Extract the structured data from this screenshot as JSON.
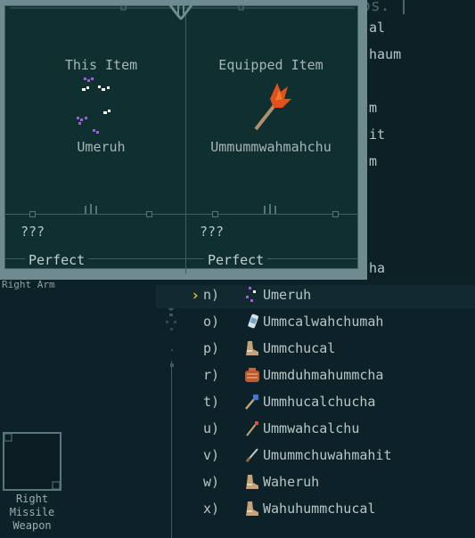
{
  "background": {
    "title_fragment": "os.",
    "visible_fragments": [
      "al",
      "haum",
      "m",
      "it",
      "m",
      "ha"
    ]
  },
  "compare": {
    "left": {
      "heading": "This Item",
      "name": "Umeruh",
      "lore": "???",
      "quality": "Perfect"
    },
    "right": {
      "heading": "Equipped Item",
      "name": "Ummummwahmahchu",
      "lore": "???",
      "quality": "Perfect"
    }
  },
  "equipment": {
    "slot_name": "Right Arm",
    "missile_slot_label": "Right\nMissile\nWeapon"
  },
  "list": {
    "selected_index": 0,
    "items": [
      {
        "key": "n)",
        "name": "Umeruh",
        "icon": "sparkle-icon",
        "color": "#9d5fd6"
      },
      {
        "key": "o)",
        "name": "Ummcalwahchumah",
        "icon": "canister-icon",
        "color": "#6fa6c9"
      },
      {
        "key": "p)",
        "name": "Ummchucal",
        "icon": "boot-icon",
        "color": "#c6a27a"
      },
      {
        "key": "r)",
        "name": "Ummduhmahummcha",
        "icon": "pot-icon",
        "color": "#c8683c"
      },
      {
        "key": "t)",
        "name": "Ummhucalchucha",
        "icon": "torch-icon",
        "color": "#3f7bd6"
      },
      {
        "key": "u)",
        "name": "Ummwahcalchu",
        "icon": "wand-icon",
        "color": "#c6a27a"
      },
      {
        "key": "v)",
        "name": "Umummchuwahmahit",
        "icon": "dagger-icon",
        "color": "#b9b9b9"
      },
      {
        "key": "w)",
        "name": "Waheruh",
        "icon": "boot-icon",
        "color": "#c6a27a"
      },
      {
        "key": "x)",
        "name": "Wahuhummchucal",
        "icon": "boot-icon",
        "color": "#c6a27a"
      }
    ]
  }
}
